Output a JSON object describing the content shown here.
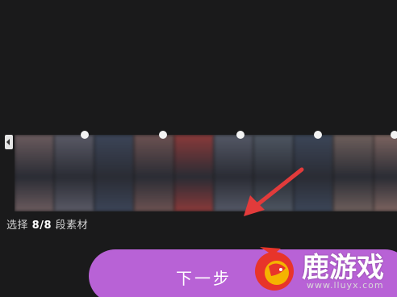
{
  "timeline": {
    "frame_colors": [
      "#6b5b5e",
      "#5a5a66",
      "#3c4558",
      "#6c5252",
      "#8a3a3a",
      "#545866",
      "#4e5662",
      "#3c4658",
      "#6e5f5c",
      "#7c6460"
    ],
    "marker_count": 5
  },
  "selection": {
    "prefix": "选择",
    "count": "8/8",
    "suffix": "段素材"
  },
  "next_button": {
    "label": "下一步",
    "color": "#b862d6"
  },
  "watermark": {
    "name": "鹿游戏",
    "url": "www.lluyx.com"
  },
  "annotation": {
    "arrow_color": "#e23b3b"
  }
}
